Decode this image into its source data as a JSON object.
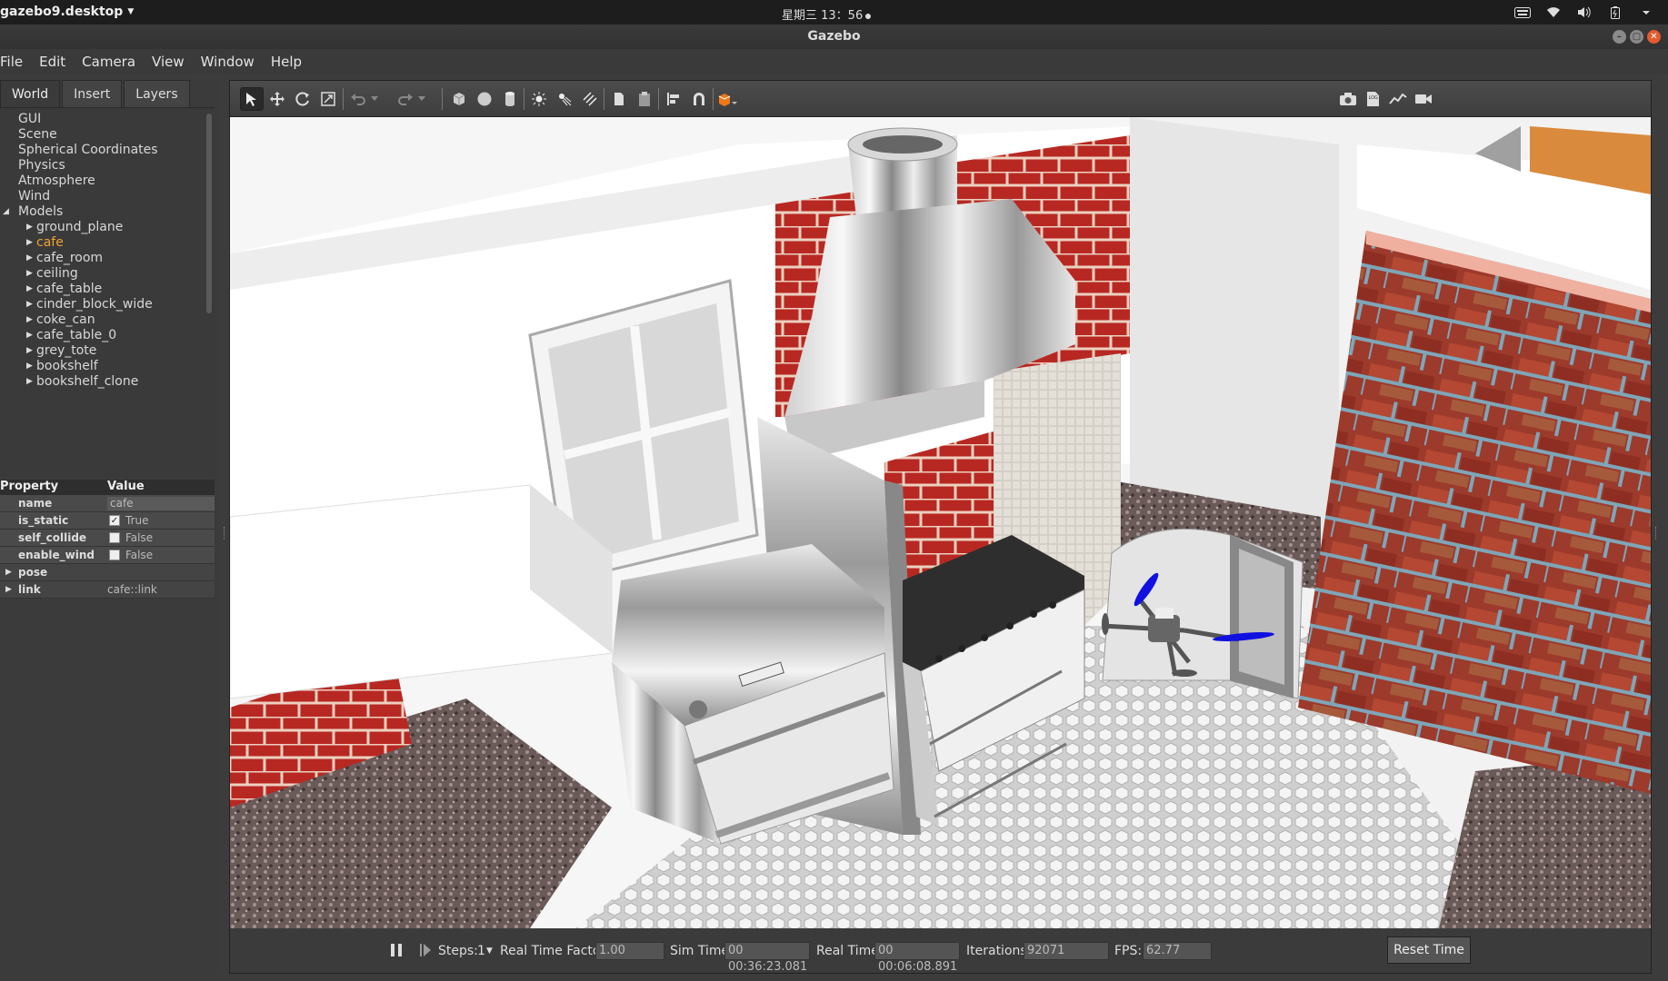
{
  "topbar": {
    "app_name": "gazebo9.desktop",
    "clock": "星期三 13：56"
  },
  "window": {
    "title": "Gazebo"
  },
  "menu": [
    "File",
    "Edit",
    "Camera",
    "View",
    "Window",
    "Help"
  ],
  "left_tabs": [
    "World",
    "Insert",
    "Layers"
  ],
  "world_tree": {
    "items": [
      "GUI",
      "Scene",
      "Spherical Coordinates",
      "Physics",
      "Atmosphere",
      "Wind"
    ],
    "models_label": "Models",
    "models": [
      "ground_plane",
      "cafe",
      "cafe_room",
      "ceiling",
      "cafe_table",
      "cinder_block_wide",
      "coke_can",
      "cafe_table_0",
      "grey_tote",
      "bookshelf",
      "bookshelf_clone"
    ],
    "selected_model": "cafe"
  },
  "properties": {
    "header_property": "Property",
    "header_value": "Value",
    "name_label": "name",
    "name_value": "cafe",
    "is_static_label": "is_static",
    "is_static_value": "True",
    "self_collide_label": "self_collide",
    "self_collide_value": "False",
    "enable_wind_label": "enable_wind",
    "enable_wind_value": "False",
    "pose_label": "pose",
    "link_label": "link",
    "link_value": "cafe::link"
  },
  "bottom": {
    "steps_label": "Steps:",
    "steps_value": "1",
    "rtf_label": "Real Time Factor:",
    "rtf_value": "1.00",
    "sim_time_label": "Sim Time:",
    "sim_time_value": "00 00:36:23.081",
    "real_time_label": "Real Time:",
    "real_time_value": "00 00:06:08.891",
    "iterations_label": "Iterations:",
    "iterations_value": "92071",
    "fps_label": "FPS:",
    "fps_value": "62.77",
    "reset_label": "Reset Time"
  },
  "colors": {
    "selected": "#f0a030",
    "brick": "#a82020",
    "propeller": "#1010e0"
  }
}
